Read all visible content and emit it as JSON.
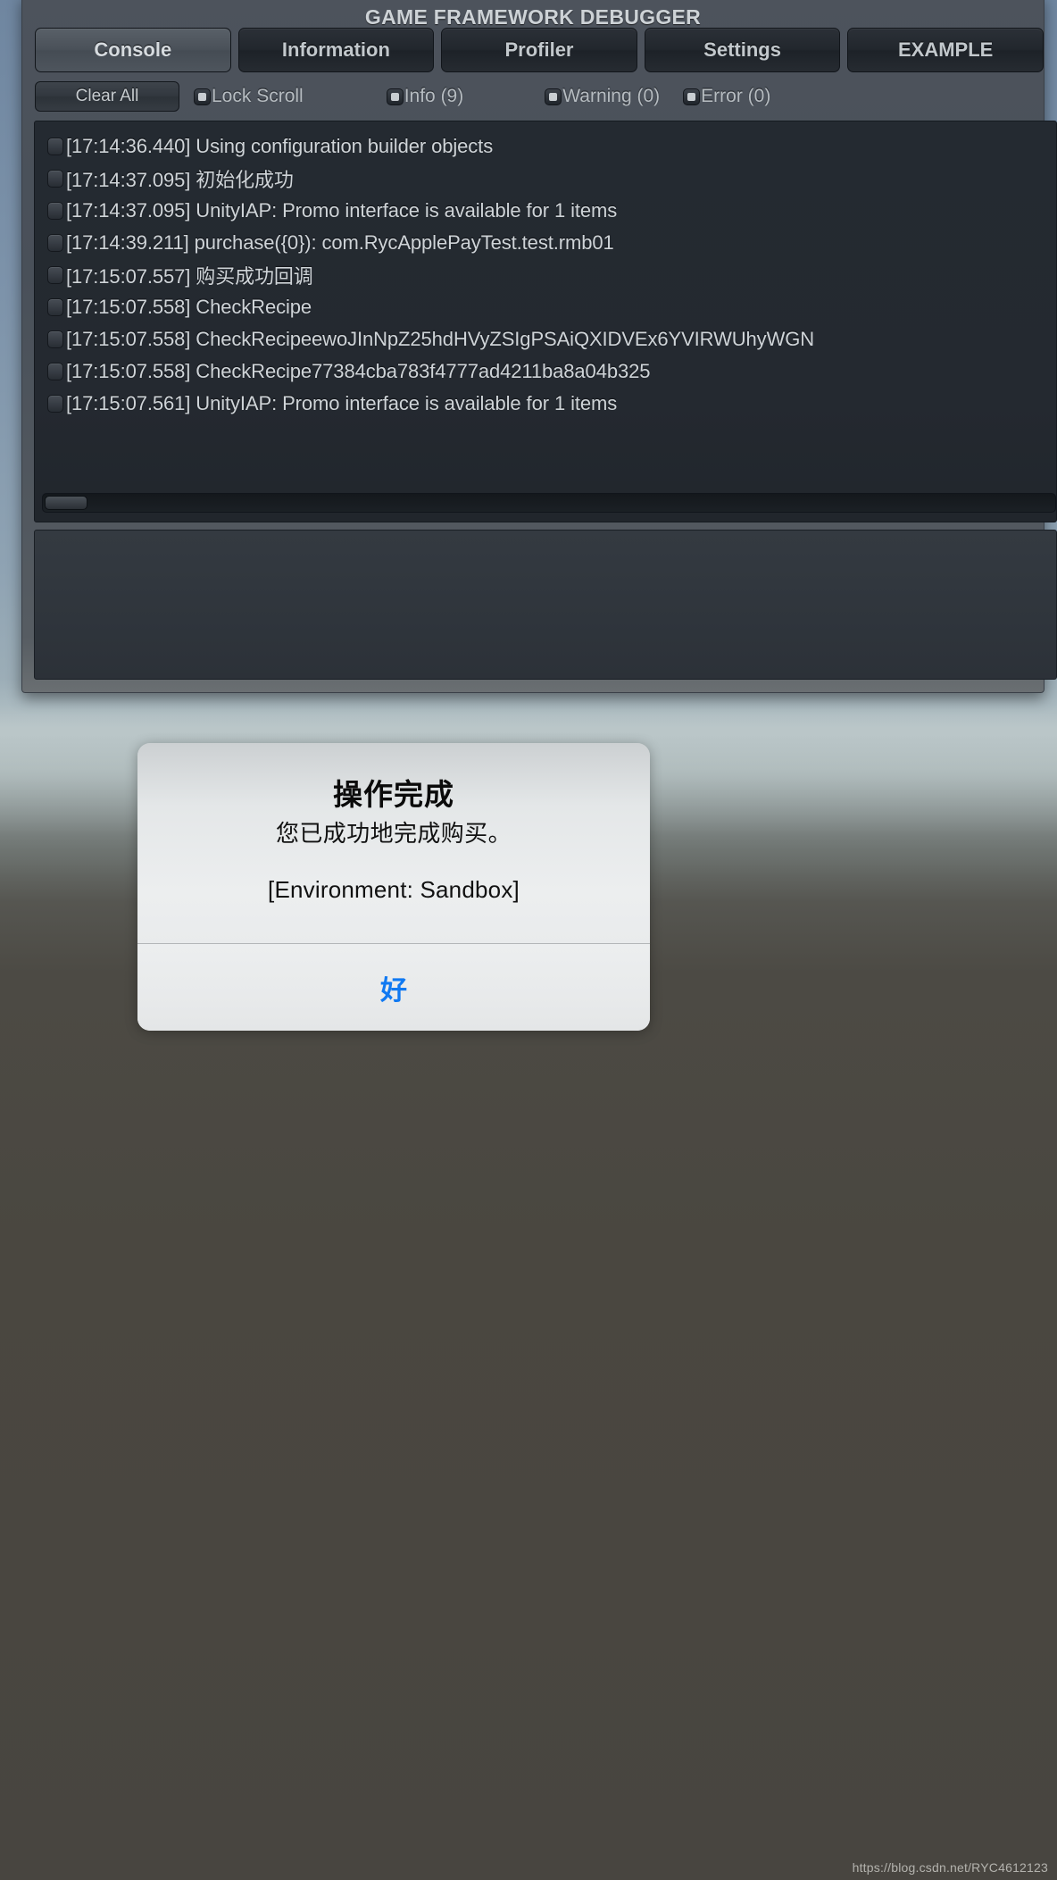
{
  "window": {
    "title": "GAME FRAMEWORK DEBUGGER"
  },
  "tabs": [
    {
      "label": "Console",
      "active": true
    },
    {
      "label": "Information",
      "active": false
    },
    {
      "label": "Profiler",
      "active": false
    },
    {
      "label": "Settings",
      "active": false
    },
    {
      "label": "EXAMPLE",
      "active": false
    }
  ],
  "toolbar": {
    "clear_all_label": "Clear All",
    "lock_scroll_label": "Lock Scroll",
    "info_label": "Info (9)",
    "warning_label": "Warning (0)",
    "error_label": "Error (0)"
  },
  "console": {
    "rows": [
      {
        "text": "[17:14:36.440] Using configuration builder objects"
      },
      {
        "text": "[17:14:37.095] 初始化成功"
      },
      {
        "text": "[17:14:37.095] UnityIAP: Promo interface is available for 1 items"
      },
      {
        "text": "[17:14:39.211] purchase({0}): com.RycApplePayTest.test.rmb01"
      },
      {
        "text": "[17:15:07.557] 购买成功回调"
      },
      {
        "text": "[17:15:07.558] CheckRecipe"
      },
      {
        "text": "[17:15:07.558] CheckRecipeewoJInNpZ25hdHVyZSIgPSAiQXIDVEx6YVIRWUhyWGN"
      },
      {
        "text": "[17:15:07.558] CheckRecipe77384cba783f4777ad4211ba8a04b325"
      },
      {
        "text": "[17:15:07.561] UnityIAP: Promo interface is available for 1 items"
      }
    ]
  },
  "alert": {
    "title": "操作完成",
    "message": "您已成功地完成购买。",
    "submessage": "[Environment: Sandbox]",
    "ok_label": "好"
  },
  "watermark": {
    "text": "https://blog.csdn.net/RYC4612123"
  },
  "colors": {
    "accent_blue": "#1079f2",
    "panel_dark": "#242a31",
    "window_bg": "#4d535c",
    "log_text": "#cfd4d8"
  }
}
